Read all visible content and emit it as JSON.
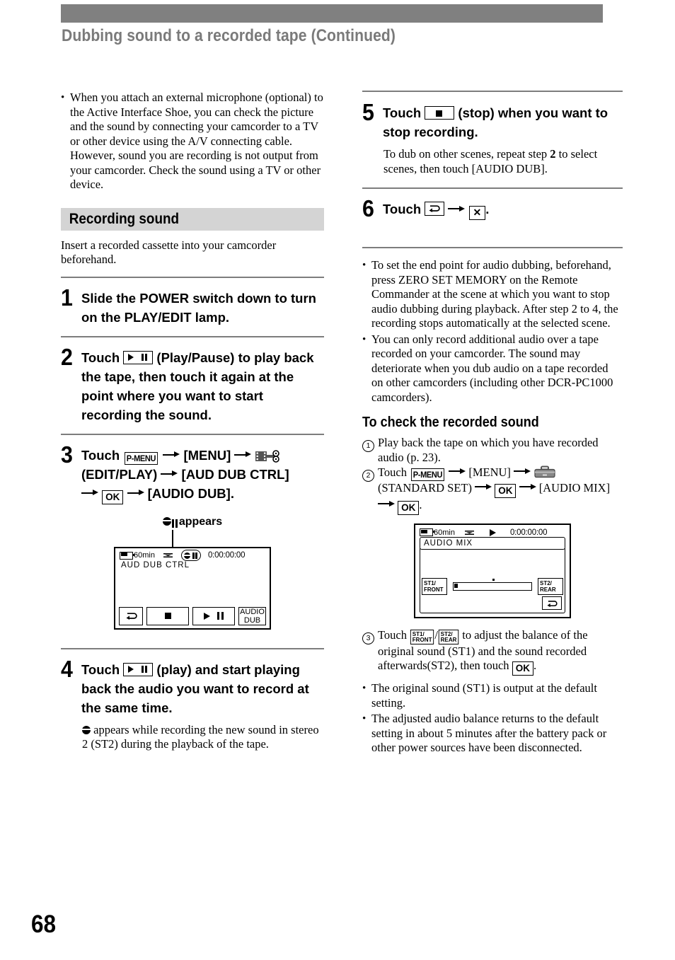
{
  "header": {
    "running_title": "Dubbing sound to a recorded tape (Continued)",
    "bar_color": "#808080",
    "title_color": "#7a7a7a"
  },
  "page_number": "68",
  "left_column": {
    "intro_bullet": "When you attach an external microphone (optional) to the Active Interface Shoe, you can check the picture and the sound by connecting your camcorder to a TV or other device using the A/V connecting cable. However, sound you are recording is not output from your camcorder. Check the sound using a TV or other device.",
    "section_heading": "Recording sound",
    "section_intro": "Insert a recorded cassette into your camcorder beforehand.",
    "steps": [
      {
        "number": "1",
        "text": "Slide the POWER switch down to turn on the PLAY/EDIT lamp."
      },
      {
        "number": "2",
        "text_a": "Touch",
        "icon": "play-pause-icon",
        "text_b": "(Play/Pause) to play back the tape, then touch it again at the point where you want to start recording the sound."
      },
      {
        "number": "3",
        "text_a": "Touch",
        "chip1": "P-MENU",
        "text_b": "[MENU]",
        "icon": "edit-play-film-icon",
        "text_c": "(EDIT/PLAY)",
        "text_d": "[AUD DUB CTRL]",
        "chip2": "OK",
        "text_e": "[AUDIO DUB]."
      },
      {
        "number": "4",
        "text_a": "Touch",
        "icon": "play-pause-icon",
        "text_b": "(play) and start playing back the audio you want to record at the same time.",
        "note": "appears while recording the new sound in stereo 2 (ST2) during the playback of the tape."
      }
    ],
    "callout_label": "appears",
    "lcd_aud_dub_ctrl": {
      "battery_time": "60min",
      "timecode": "0:00:00:00",
      "mode_label": "AUD  DUB  CTRL",
      "indicator": "audio-dub-pause-indicator",
      "buttons": [
        {
          "name": "return-button",
          "label": ""
        },
        {
          "name": "stop-button",
          "label": ""
        },
        {
          "name": "play-pause-button",
          "label": ""
        },
        {
          "name": "audio-dub-button",
          "label_line1": "AUDIO",
          "label_line2": "DUB"
        }
      ]
    }
  },
  "right_column": {
    "steps": [
      {
        "number": "5",
        "text_a": "Touch",
        "icon": "stop-icon",
        "text_b": "(stop) when you want to stop recording.",
        "note_a": "To dub on other scenes, repeat step",
        "note_bold": "2",
        "note_b": "to select scenes, then touch [AUDIO DUB]."
      },
      {
        "number": "6",
        "text_a": "Touch",
        "icon1": "return-icon",
        "icon2": "close-x-icon",
        "text_b": "."
      }
    ],
    "notes": [
      "To set the end point for audio dubbing, beforehand, press ZERO SET MEMORY on the Remote Commander at the scene at which you want to stop audio dubbing during playback. After step 2 to 4, the recording stops automatically at the selected scene.",
      "You can only record additional audio over a tape recorded on your camcorder. The sound may deteriorate when you dub audio on a tape recorded on other camcorders (including other DCR-PC1000 camcorders)."
    ],
    "check_heading": "To check the recorded sound",
    "check_items": [
      {
        "marker": "1",
        "text": "Play back the tape on which you have recorded audio (p. 23)."
      },
      {
        "marker": "2",
        "text_a": "Touch",
        "chip1": "P-MENU",
        "text_b": "[MENU]",
        "icon": "standard-set-toolbox-icon",
        "text_c": "(STANDARD SET)",
        "chip2": "OK",
        "text_d": "[AUDIO MIX]",
        "chip3": "OK",
        "text_e": "."
      },
      {
        "marker": "3",
        "text_a": "Touch",
        "chip_st1": {
          "line1": "ST1/",
          "line2": "FRONT"
        },
        "separator": "/",
        "chip_st2": {
          "line1": "ST2/",
          "line2": "REAR"
        },
        "text_b": "to adjust the balance of the original sound (ST1) and the sound recorded afterwards(ST2), then touch",
        "chip_ok": "OK",
        "text_c": "."
      }
    ],
    "check_notes": [
      "The original sound (ST1) is output at the default setting.",
      "The adjusted audio balance returns to the default setting in about 5 minutes after the battery pack or other power sources have been disconnected."
    ],
    "lcd_audio_mix": {
      "battery_time": "60min",
      "timecode": "0:00:00:00",
      "title": "AUDIO  MIX",
      "left_button": {
        "line1": "ST1/",
        "line2": "FRONT"
      },
      "right_button": {
        "line1": "ST2/",
        "line2": "REAR"
      },
      "return_button": "return-button"
    }
  }
}
